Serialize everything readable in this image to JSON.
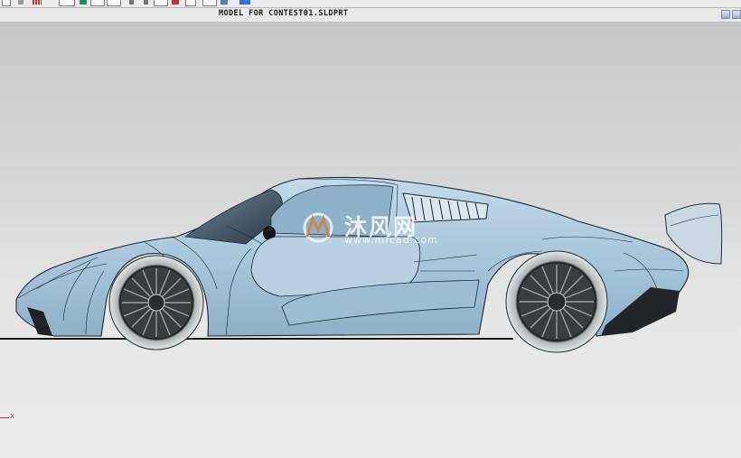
{
  "window": {
    "document_title": "MODEL FOR CONTEST01.SLDPRT"
  },
  "viewport": {
    "axis_label": "X",
    "watermark": {
      "chinese": "沐风网",
      "url": "www.mfcad.com"
    }
  },
  "colors": {
    "body": "#a9c7dc",
    "body_shadow": "#7f9fb6",
    "edges": "#1c2a36",
    "tire": "#d6dcdc",
    "rim": "#3a3d40",
    "axis": "#c4303a"
  }
}
